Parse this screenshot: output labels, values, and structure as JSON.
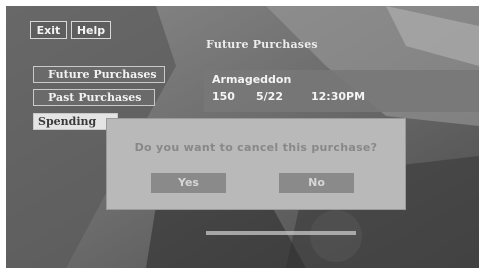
{
  "top_bar": {
    "exit_label": "Exit",
    "help_label": "Help"
  },
  "screen_title": "Future Purchases",
  "menu": {
    "items": [
      {
        "label": "Future Purchases"
      },
      {
        "label": "Past Purchases"
      },
      {
        "label": "Spending"
      }
    ]
  },
  "purchase": {
    "title": "Armageddon",
    "channel": "150",
    "date": "5/22",
    "time": "12:30PM"
  },
  "dialog": {
    "message": "Do you want to cancel this purchase?",
    "yes_label": "Yes",
    "no_label": "No"
  }
}
